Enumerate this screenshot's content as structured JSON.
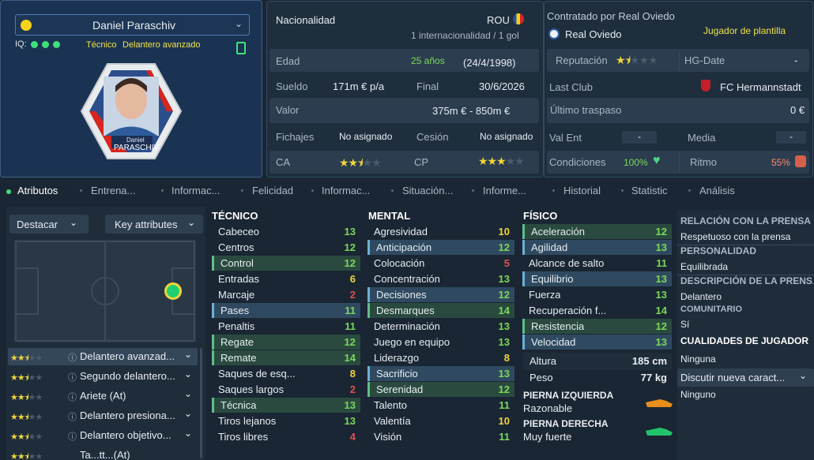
{
  "player": {
    "name": "Daniel Paraschiv",
    "iq_label": "IQ:",
    "role_line_1": "Técnico",
    "role_line_2": "Delantero avanzado",
    "badge_name_small": "Daniel",
    "badge_name_big": "PARASCHIV"
  },
  "info": {
    "nacionalidad_label": "Nacionalidad",
    "nacionalidad_val": "ROU",
    "internacional": "1 internacionalidad / 1 gol",
    "edad_label": "Edad",
    "edad_val": "25 años",
    "edad_fecha": "(24/4/1998)",
    "sueldo_label": "Sueldo",
    "sueldo_val": "171m € p/a",
    "final_label": "Final",
    "final_val": "30/6/2026",
    "valor_label": "Valor",
    "valor_val": "375m € - 850m €",
    "fichajes_label": "Fichajes",
    "fichajes_val": "No asignado",
    "cesion_label": "Cesión",
    "cesion_val": "No asignado",
    "ca_label": "CA",
    "cp_label": "CP",
    "ca_stars": 2.5,
    "cp_stars": 3
  },
  "club": {
    "contratado_label": "Contratado por Real Oviedo",
    "club_name": "Real Oviedo",
    "status": "Jugador de plantilla",
    "reputacion_label": "Reputación",
    "reputacion_stars": 1.5,
    "hgdate_label": "HG-Date",
    "hgdate_val": "-",
    "lastclub_label": "Last Club",
    "lastclub_val": "FC Hermannstadt",
    "ultimo_label": "Último traspaso",
    "ultimo_val": "0 €",
    "valent_label": "Val Ent",
    "valent_val": "-",
    "media_label": "Media",
    "media_val": "-",
    "condiciones_label": "Condiciones",
    "condiciones_val": "100%",
    "ritmo_label": "Ritmo",
    "ritmo_val": "55%"
  },
  "tabs": [
    "Atributos",
    "Entrena...",
    "Informac...",
    "Felicidad",
    "Informac...",
    "Situación...",
    "Informe...",
    "Historial",
    "Statistic",
    "Análisis"
  ],
  "left": {
    "destacar": "Destacar",
    "key_attributes": "Key attributes",
    "roles": [
      {
        "label": "Delantero avanzad...",
        "stars": 2.5
      },
      {
        "label": "Segundo delantero...",
        "stars": 2.5
      },
      {
        "label": "Ariete (At)",
        "stars": 2.5
      },
      {
        "label": "Delantero presiona...",
        "stars": 2.5
      },
      {
        "label": "Delantero objetivo...",
        "stars": 2.5
      },
      {
        "label": "Ta...tt...(At)",
        "stars": 2.5
      }
    ]
  },
  "tecnico": {
    "title": "TÉCNICO",
    "rows": [
      {
        "name": "Cabeceo",
        "value": "13",
        "hl": ""
      },
      {
        "name": "Centros",
        "value": "12",
        "hl": ""
      },
      {
        "name": "Control",
        "value": "12",
        "hl": "g"
      },
      {
        "name": "Entradas",
        "value": "6",
        "hl": ""
      },
      {
        "name": "Marcaje",
        "value": "2",
        "hl": ""
      },
      {
        "name": "Pases",
        "value": "11",
        "hl": "b"
      },
      {
        "name": "Penaltis",
        "value": "11",
        "hl": ""
      },
      {
        "name": "Regate",
        "value": "12",
        "hl": "g"
      },
      {
        "name": "Remate",
        "value": "14",
        "hl": "g"
      },
      {
        "name": "Saques de esq...",
        "value": "8",
        "hl": ""
      },
      {
        "name": "Saques largos",
        "value": "2",
        "hl": ""
      },
      {
        "name": "Técnica",
        "value": "13",
        "hl": "g"
      },
      {
        "name": "Tiros lejanos",
        "value": "13",
        "hl": ""
      },
      {
        "name": "Tiros libres",
        "value": "4",
        "hl": ""
      }
    ]
  },
  "mental": {
    "title": "MENTAL",
    "rows": [
      {
        "name": "Agresividad",
        "value": "10",
        "hl": ""
      },
      {
        "name": "Anticipación",
        "value": "12",
        "hl": "b"
      },
      {
        "name": "Colocación",
        "value": "5",
        "hl": ""
      },
      {
        "name": "Concentración",
        "value": "13",
        "hl": ""
      },
      {
        "name": "Decisiones",
        "value": "12",
        "hl": "b"
      },
      {
        "name": "Desmarques",
        "value": "14",
        "hl": "g"
      },
      {
        "name": "Determinación",
        "value": "13",
        "hl": ""
      },
      {
        "name": "Juego en equipo",
        "value": "13",
        "hl": ""
      },
      {
        "name": "Liderazgo",
        "value": "8",
        "hl": ""
      },
      {
        "name": "Sacrificio",
        "value": "13",
        "hl": "b"
      },
      {
        "name": "Serenidad",
        "value": "12",
        "hl": "g"
      },
      {
        "name": "Talento",
        "value": "11",
        "hl": ""
      },
      {
        "name": "Valentía",
        "value": "10",
        "hl": ""
      },
      {
        "name": "Visión",
        "value": "11",
        "hl": ""
      }
    ]
  },
  "fisico": {
    "title": "FÍSICO",
    "rows": [
      {
        "name": "Aceleración",
        "value": "12",
        "hl": "g"
      },
      {
        "name": "Agilidad",
        "value": "13",
        "hl": "b"
      },
      {
        "name": "Alcance de salto",
        "value": "11",
        "hl": ""
      },
      {
        "name": "Equilibrio",
        "value": "13",
        "hl": "b"
      },
      {
        "name": "Fuerza",
        "value": "13",
        "hl": ""
      },
      {
        "name": "Recuperación f...",
        "value": "14",
        "hl": ""
      },
      {
        "name": "Resistencia",
        "value": "12",
        "hl": "g"
      },
      {
        "name": "Velocidad",
        "value": "13",
        "hl": "b"
      }
    ],
    "altura_label": "Altura",
    "altura_val": "185 cm",
    "peso_label": "Peso",
    "peso_val": "77 kg",
    "pierna_izq_label": "PIERNA IZQUIERDA",
    "pierna_izq_val": "Razonable",
    "pierna_der_label": "PIERNA DERECHA",
    "pierna_der_val": "Muy fuerte"
  },
  "right": {
    "relacion_title": "RELACIÓN CON LA PRENSA",
    "relacion_val": "Respetuoso con la prensa",
    "personalidad_title": "PERSONALIDAD",
    "personalidad_val": "Equilibrada",
    "descripcion_title": "DESCRIPCIÓN DE LA PRENSA",
    "descripcion_val": "Delantero",
    "comunitario_title": "COMUNITARIO",
    "comunitario_val": "Sí",
    "cualidades_title": "CUALIDADES DE JUGADOR",
    "cualidades_val": "Ninguna",
    "discutir_label": "Discutir nueva caract...",
    "ninguno_val": "Ninguno"
  },
  "colors": {
    "green": "#7cd85a",
    "yellow": "#f0d43c",
    "red": "#e05050",
    "accent": "#4a7eb8"
  }
}
